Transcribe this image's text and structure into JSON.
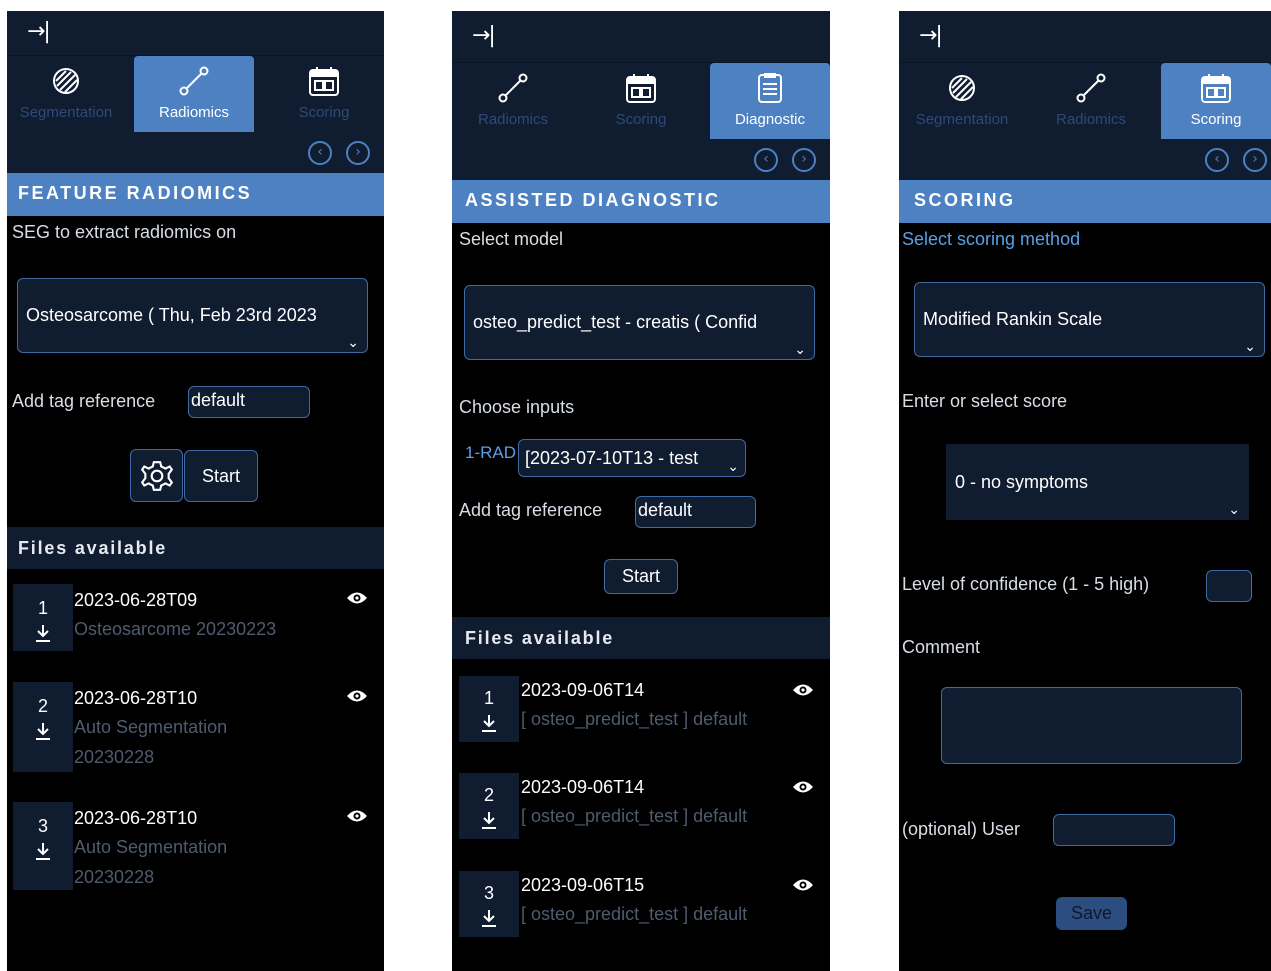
{
  "panel1": {
    "collapse_icon": "→|",
    "tabs": [
      {
        "label": "Segmentation",
        "icon": "segmentation-icon",
        "active": false
      },
      {
        "label": "Radiomics",
        "icon": "radiomics-icon",
        "active": true
      },
      {
        "label": "Scoring",
        "icon": "scoring-icon",
        "active": false
      }
    ],
    "section_title": "FEATURE RADIOMICS",
    "seg_label": "SEG to extract radiomics on",
    "seg_value": "Osteosarcome ( Thu, Feb 23rd 2023",
    "tag_label": "Add tag reference",
    "tag_value": "default",
    "start_label": "Start",
    "files_title": "Files available",
    "files": [
      {
        "num": "1",
        "name": "2023-06-28T09",
        "sub": "Osteosarcome 20230223"
      },
      {
        "num": "2",
        "name": "2023-06-28T10",
        "sub": "Auto Segmentation 20230228"
      },
      {
        "num": "3",
        "name": "2023-06-28T10",
        "sub": "Auto Segmentation 20230228"
      }
    ]
  },
  "panel2": {
    "collapse_icon": "→|",
    "tabs": [
      {
        "label": "Radiomics",
        "icon": "radiomics-icon",
        "active": false
      },
      {
        "label": "Scoring",
        "icon": "scoring-icon",
        "active": false
      },
      {
        "label": "Diagnostic",
        "icon": "diagnostic-icon",
        "active": true
      }
    ],
    "section_title": "ASSISTED DIAGNOSTIC",
    "model_label": "Select model",
    "model_value": "osteo_predict_test - creatis ( Confid",
    "inputs_label": "Choose inputs",
    "input_name": "1-RAD",
    "input_value": "[2023-07-10T13 - test",
    "tag_label": "Add tag reference",
    "tag_value": "default",
    "start_label": "Start",
    "files_title": "Files available",
    "files": [
      {
        "num": "1",
        "name": "2023-09-06T14",
        "sub": "[ osteo_predict_test ] default"
      },
      {
        "num": "2",
        "name": "2023-09-06T14",
        "sub": "[ osteo_predict_test ] default"
      },
      {
        "num": "3",
        "name": "2023-09-06T15",
        "sub": "[ osteo_predict_test ] default"
      }
    ]
  },
  "panel3": {
    "collapse_icon": "→|",
    "tabs": [
      {
        "label": "Segmentation",
        "icon": "segmentation-icon",
        "active": false
      },
      {
        "label": "Radiomics",
        "icon": "radiomics-icon",
        "active": false
      },
      {
        "label": "Scoring",
        "icon": "scoring-icon",
        "active": true
      }
    ],
    "section_title": "SCORING",
    "method_label": "Select scoring method",
    "method_value": "Modified Rankin Scale",
    "score_label": "Enter or select score",
    "score_value": "0 - no symptoms",
    "confidence_label": "Level of confidence (1 - 5 high)",
    "confidence_value": "",
    "comment_label": "Comment",
    "comment_value": "",
    "user_label": "(optional) User",
    "user_value": "",
    "save_label": "Save"
  },
  "colors": {
    "accent": "#4e81c2",
    "panel_dark": "#101c30",
    "background": "#000000",
    "muted_text": "#4f5b6e",
    "link_blue": "#5aa0e6"
  }
}
